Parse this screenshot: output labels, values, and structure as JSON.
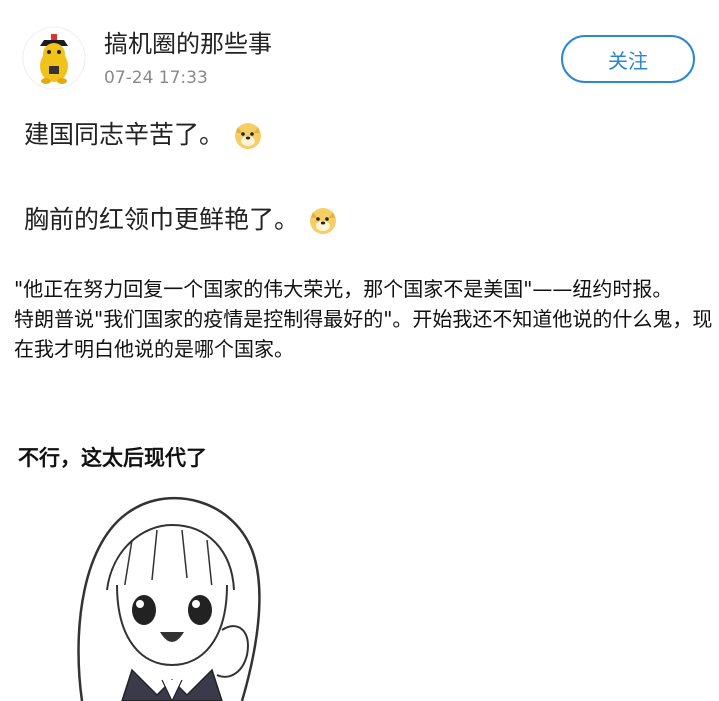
{
  "post": {
    "author": "搞机圈的那些事",
    "timestamp": "07-24 17:33",
    "follow_label": "关注",
    "lines": [
      "建国同志辛苦了。",
      "胸前的红领巾更鲜艳了。"
    ],
    "emoji_name": "doge-emoji"
  },
  "meme": {
    "text": "\"他正在努力回复一个国家的伟大荣光，那个国家不是美国\"——纽约时报。\n特朗普说\"我们国家的疫情是控制得最好的\"。开始我还不知道他说的什么鬼，现在我才明白他说的是哪个国家。",
    "caption": "不行，这太后现代了"
  }
}
